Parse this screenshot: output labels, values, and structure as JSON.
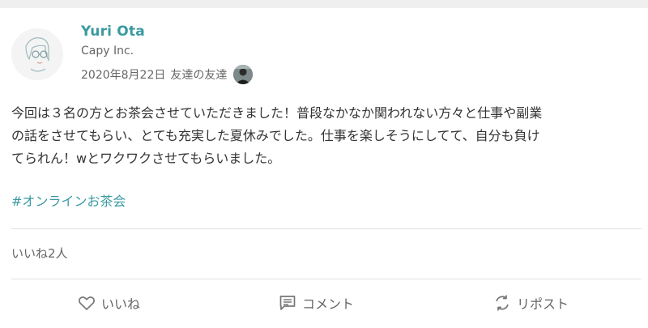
{
  "post": {
    "author": {
      "name": "Yuri Ota",
      "company": "Capy Inc."
    },
    "date": "2020年8月22日",
    "visibility": "友達の友達",
    "body_lines": [
      "今回は３名の方とお茶会させていただきました！普段なかなか関われない方々と仕事や副業",
      "の話をさせてもらい、とても充実した夏休みでした。仕事を楽しそうにしてて、自分も負け",
      "てられん！wとワクワクさせてもらいました。"
    ],
    "hashtag": "#オンラインお茶会",
    "likes_summary": "いいね2人"
  },
  "actions": {
    "like_label": "いいね",
    "comment_label": "コメント",
    "repost_label": "リポスト"
  },
  "icons": {
    "like": "heart-icon",
    "comment": "comment-icon",
    "repost": "repost-icon"
  },
  "colors": {
    "accent": "#3a9aa0",
    "text": "#333333",
    "muted": "#666666",
    "divider": "#e2e2e2",
    "background": "#efefef"
  }
}
